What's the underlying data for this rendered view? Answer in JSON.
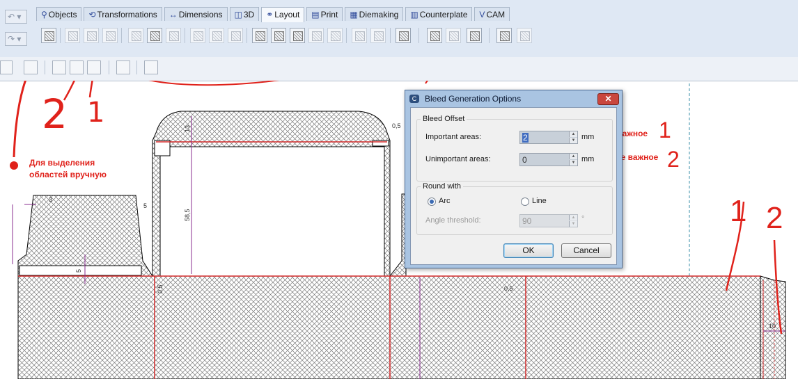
{
  "quick_access": {
    "undo_label": "↶ ▾",
    "redo_label": "↷ ▾"
  },
  "tabs": [
    {
      "icon": "⚲",
      "label": "Objects"
    },
    {
      "icon": "⟲",
      "label": "Transformations"
    },
    {
      "icon": "↔",
      "label": "Dimensions"
    },
    {
      "icon": "◫",
      "label": "3D"
    },
    {
      "icon": "⚭",
      "label": "Layout"
    },
    {
      "icon": "▤",
      "label": "Print"
    },
    {
      "icon": "▦",
      "label": "Diemaking"
    },
    {
      "icon": "▥",
      "label": "Counterplate"
    },
    {
      "icon": "V",
      "label": "CAM"
    }
  ],
  "active_tab": "Layout",
  "dialog": {
    "title": "Bleed Generation Options",
    "close_glyph": "✕",
    "bleed_offset_legend": "Bleed Offset",
    "important_label": "Important areas:",
    "important_value": "2",
    "unimportant_label": "Unimportant areas:",
    "unimportant_value": "0",
    "unit": "mm",
    "round_with_legend": "Round with",
    "arc_label": "Arc",
    "line_label": "Line",
    "round_selected": "Arc",
    "angle_label": "Angle threshold:",
    "angle_value": "90",
    "angle_unit": "°",
    "ok_label": "OK",
    "cancel_label": "Cancel"
  },
  "annotations": {
    "manual_selection": "Для выделения областей вручную",
    "important": "Важное",
    "not_important": "Не важное",
    "num_1": "1",
    "num_2": "2"
  },
  "dimensions": {
    "d13": "13",
    "d05": "0,5",
    "d5": "5",
    "d585": "58,5",
    "d10": "10",
    "d3": "3"
  },
  "colors": {
    "annotation": "#e0221b",
    "cut_line": "#d42a2a",
    "dim_line": "#8a2c8f",
    "ribbon": "#dfe8f4"
  }
}
